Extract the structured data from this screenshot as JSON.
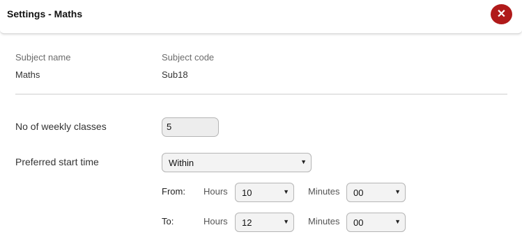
{
  "dialog": {
    "title": "Settings - Maths",
    "close_icon": "close-icon",
    "close_glyph": "✕"
  },
  "subject": {
    "name_label": "Subject name",
    "name_value": "Maths",
    "code_label": "Subject code",
    "code_value": "Sub18"
  },
  "weekly_classes": {
    "label": "No of weekly classes",
    "value": "5"
  },
  "start_time": {
    "label": "Preferred start time",
    "mode": "Within",
    "caret": "▼",
    "from": {
      "label": "From:",
      "hours_label": "Hours",
      "hours_value": "10",
      "minutes_label": "Minutes",
      "minutes_value": "00"
    },
    "to": {
      "label": "To:",
      "hours_label": "Hours",
      "hours_value": "12",
      "minutes_label": "Minutes",
      "minutes_value": "00"
    }
  },
  "colors": {
    "close_button": "#b01a1a",
    "divider": "#cfcfcf"
  }
}
